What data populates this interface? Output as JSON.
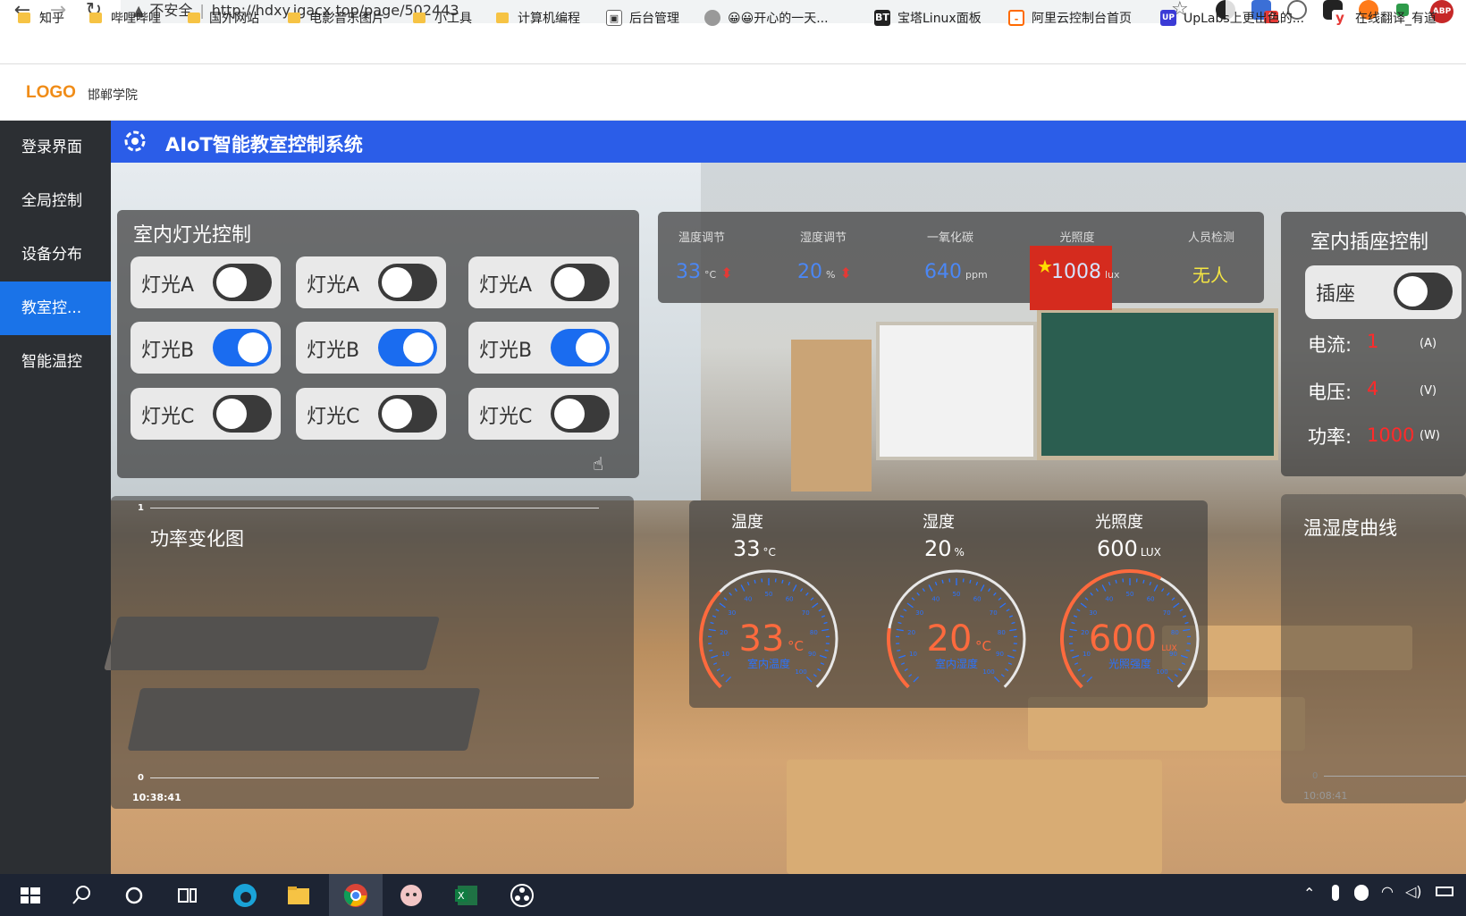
{
  "browser": {
    "security_label": "不安全",
    "url": "http://hdxy.jgacx.top/page/502443",
    "bookmarks": [
      {
        "label": "知乎",
        "icon": "folder-icon"
      },
      {
        "label": "哔哩哔哩",
        "icon": "folder-icon"
      },
      {
        "label": "国外网站",
        "icon": "folder-icon"
      },
      {
        "label": "电影音乐图片",
        "icon": "folder-icon"
      },
      {
        "label": "小工具",
        "icon": "folder-icon"
      },
      {
        "label": "计算机编程",
        "icon": "folder-icon"
      },
      {
        "label": "后台管理",
        "icon": "image-icon"
      },
      {
        "label": "😀😀开心的一天...",
        "icon": "globe-icon"
      },
      {
        "label": "宝塔Linux面板",
        "icon": "bt-icon"
      },
      {
        "label": "阿里云控制台首页",
        "icon": "aliyun-icon"
      },
      {
        "label": "UpLabs上更出色的...",
        "icon": "uplabs-icon"
      },
      {
        "label": "在线翻译_有道",
        "icon": "youdao-icon"
      }
    ],
    "ext_badge": "9",
    "abp_label": "ABP"
  },
  "site": {
    "logo": "LOGO",
    "school": "邯郸学院",
    "title": "AIoT智能教室控制系统"
  },
  "sidebar": {
    "items": [
      {
        "label": "登录界面",
        "active": false
      },
      {
        "label": "全局控制",
        "active": false
      },
      {
        "label": "设备分布",
        "active": false
      },
      {
        "label": "教室控...",
        "active": true
      },
      {
        "label": "智能温控",
        "active": false
      }
    ]
  },
  "lights": {
    "title": "室内灯光控制",
    "toggles": [
      {
        "label": "灯光A",
        "on": false
      },
      {
        "label": "灯光A",
        "on": false
      },
      {
        "label": "灯光A",
        "on": false
      },
      {
        "label": "灯光B",
        "on": true
      },
      {
        "label": "灯光B",
        "on": true
      },
      {
        "label": "灯光B",
        "on": true
      },
      {
        "label": "灯光C",
        "on": false
      },
      {
        "label": "灯光C",
        "on": false
      },
      {
        "label": "灯光C",
        "on": false
      }
    ]
  },
  "env": {
    "items": [
      {
        "label": "温度调节",
        "value": "33",
        "unit": "°C"
      },
      {
        "label": "湿度调节",
        "value": "20",
        "unit": "%"
      },
      {
        "label": "一氧化碳",
        "value": "640",
        "unit": "ppm"
      },
      {
        "label": "光照度",
        "value": "1008",
        "unit": "lux"
      },
      {
        "label": "人员检测",
        "value": "无人",
        "unit": ""
      }
    ]
  },
  "socket": {
    "title": "室内插座控制",
    "toggle_label": "插座",
    "on": false,
    "current_label": "电流:",
    "current_value": "1",
    "current_unit": "(A)",
    "voltage_label": "电压:",
    "voltage_value": "4",
    "voltage_unit": "(V)",
    "power_label": "功率:",
    "power_value": "1000",
    "power_unit": "(W)"
  },
  "power_chart": {
    "title": "功率变化图",
    "y_top": "1",
    "y_bottom": "0",
    "time": "10:38:41"
  },
  "gauges": {
    "items": [
      {
        "header": "温度",
        "value": "33",
        "unit": "°C",
        "gauge_unit": "°C",
        "caption": "室内温度",
        "level": 0.33
      },
      {
        "header": "湿度",
        "value": "20",
        "unit": "%",
        "gauge_unit": "°C",
        "caption": "室内湿度",
        "level": 0.2
      },
      {
        "header": "光照度",
        "value": "600",
        "unit": "LUX",
        "gauge_unit": "LUX",
        "caption": "光照强度",
        "level": 0.6
      }
    ],
    "ticks": [
      "10",
      "20",
      "30",
      "40",
      "50",
      "60",
      "70",
      "80",
      "90",
      "100"
    ]
  },
  "curve_chart": {
    "title": "温湿度曲线",
    "y_bottom": "0",
    "time": "10:08:41"
  },
  "colors": {
    "accent": "#2b5de8",
    "sidebar_active": "#1a73e8",
    "gauge_value": "#ff6a3d",
    "env_value": "#4b87f5",
    "alert_value": "#ff2a2a",
    "person_value": "#f5e642"
  }
}
